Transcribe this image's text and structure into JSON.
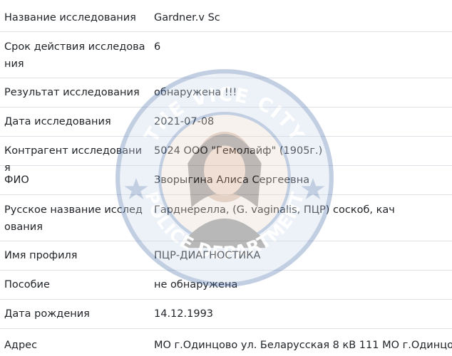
{
  "record": {
    "rows": [
      {
        "label": "Название исследования",
        "value": "Gardner.v Sc"
      },
      {
        "label": "Срок действия исследования",
        "value": "6"
      },
      {
        "label": "Результат исследования",
        "value": "обнаружена !!!"
      },
      {
        "label": "Дата исследования",
        "value": "2021-07-08"
      },
      {
        "label": "Контрагент исследования",
        "value": "5024 ООО \"Гемолайф\" (1905г.)"
      },
      {
        "label": "ФИО",
        "value": "Зворыгина Алиса Сергеевна"
      },
      {
        "label": "Русское название исследования",
        "value": "Гарднерелла, (G. vaginalis, ПЦР) соскоб, кач"
      },
      {
        "label": "Имя профиля",
        "value": "ПЦР-ДИАГНОСТИКА"
      },
      {
        "label": "Пособие",
        "value": "не обнаружена"
      },
      {
        "label": "Дата рождения",
        "value": "14.12.1993"
      },
      {
        "label": "Адрес",
        "value": "МО г.Одинцово ул. Беларусская 8 кВ 111 МО г.Одинцо"
      }
    ]
  },
  "watermark": {
    "top_text": "THE VICE CITY",
    "bottom_text": "POLICE DEPARTMENT",
    "ring_color": "#4a6fa8",
    "fill_color": "#c9d6ea"
  }
}
